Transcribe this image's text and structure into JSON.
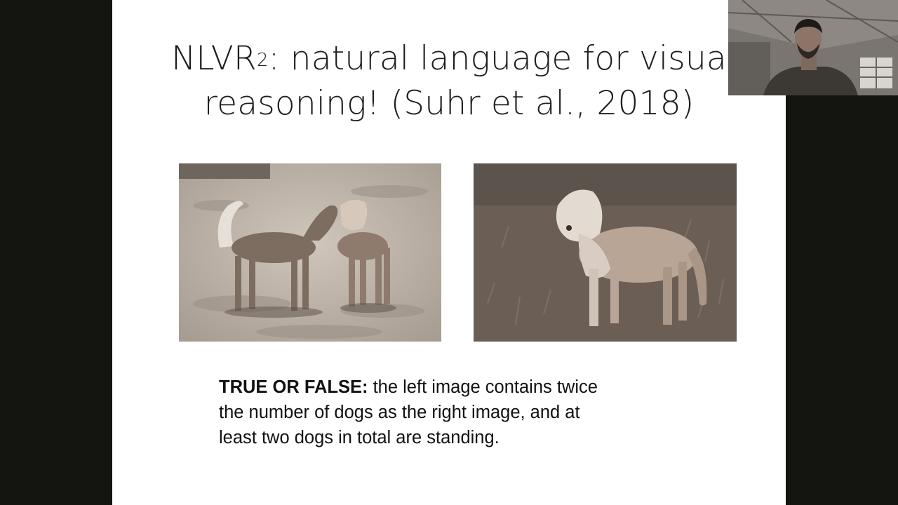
{
  "slide": {
    "title_prefix": "NLVR",
    "title_superscript": "2",
    "title_rest": ": natural language for  visua",
    "title_line2": "reasoning! (Suhr et al., 2018)",
    "images": [
      {
        "name": "left-image",
        "icon": "two-dogs-photo"
      },
      {
        "name": "right-image",
        "icon": "one-dog-photo"
      }
    ],
    "question_label": "TRUE OR FALSE:",
    "question_line1": " the left image contains twice",
    "question_line2": "the number of dogs as the right image, and at",
    "question_line3": "least two dogs in total are standing."
  },
  "webcam": {
    "icon": "presenter-video"
  },
  "colors": {
    "background": "#141410",
    "slide": "#ffffff",
    "text": "#1e1e1e",
    "photo_tint": "#a89c90"
  }
}
